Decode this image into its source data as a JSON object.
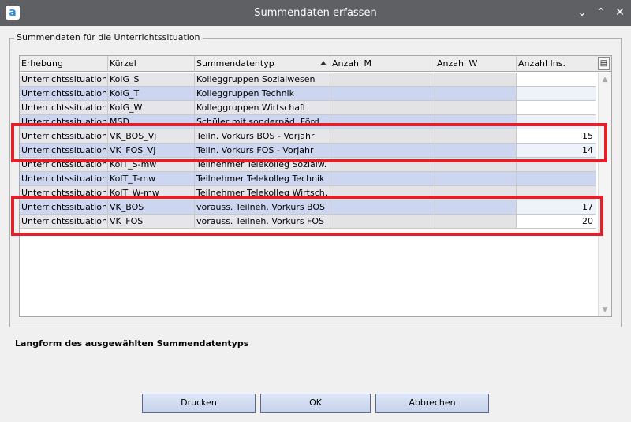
{
  "window": {
    "title": "Summendaten erfassen",
    "logo": "a"
  },
  "group_label": "Summendaten für die Unterrichtssituation",
  "columns": [
    "Erhebung",
    "Kürzel",
    "Summendatentyp",
    "Anzahl M",
    "Anzahl W",
    "Anzahl Ins."
  ],
  "rows": [
    {
      "erhebung": "Unterrichtssituation",
      "kuerzel": "KolG_S",
      "typ": "Kolleggruppen Sozialwesen",
      "m": "",
      "w": "",
      "ins": ""
    },
    {
      "erhebung": "Unterrichtssituation",
      "kuerzel": "KolG_T",
      "typ": "Kolleggruppen Technik",
      "m": "",
      "w": "",
      "ins": ""
    },
    {
      "erhebung": "Unterrichtssituation",
      "kuerzel": "KolG_W",
      "typ": "Kolleggruppen Wirtschaft",
      "m": "",
      "w": "",
      "ins": ""
    },
    {
      "erhebung": "Unterrichtssituation",
      "kuerzel": "MSD",
      "typ": "Schüler mit sonderpäd. Förd.",
      "m": "",
      "w": "",
      "ins": ""
    },
    {
      "erhebung": "Unterrichtssituation",
      "kuerzel": "VK_BOS_Vj",
      "typ": "Teiln. Vorkurs BOS - Vorjahr",
      "m": "",
      "w": "",
      "ins": "15"
    },
    {
      "erhebung": "Unterrichtssituation",
      "kuerzel": "VK_FOS_Vj",
      "typ": "Teiln. Vorkurs FOS - Vorjahr",
      "m": "",
      "w": "",
      "ins": "14"
    },
    {
      "erhebung": "Unterrichtssituation",
      "kuerzel": "KolT_S-mw",
      "typ": "Teilnehmer Telekolleg Sozialw.",
      "m": "",
      "w": "",
      "ins": ""
    },
    {
      "erhebung": "Unterrichtssituation",
      "kuerzel": "KolT_T-mw",
      "typ": "Teilnehmer Telekolleg Technik",
      "m": "",
      "w": "",
      "ins": ""
    },
    {
      "erhebung": "Unterrichtssituation",
      "kuerzel": "KolT_W-mw",
      "typ": "Teilnehmer Telekolleg Wirtsch.",
      "m": "",
      "w": "",
      "ins": ""
    },
    {
      "erhebung": "Unterrichtssituation",
      "kuerzel": "VK_BOS",
      "typ": "vorauss. Teilneh. Vorkurs BOS",
      "m": "",
      "w": "",
      "ins": "17"
    },
    {
      "erhebung": "Unterrichtssituation",
      "kuerzel": "VK_FOS",
      "typ": "vorauss. Teilneh. Vorkurs FOS",
      "m": "",
      "w": "",
      "ins": "20"
    }
  ],
  "longform_label": "Langform des ausgewählten Summendatentyps",
  "buttons": {
    "print": "Drucken",
    "ok": "OK",
    "cancel": "Abbrechen"
  },
  "icons": {
    "minimize": "chevron-down-icon",
    "maximize": "chevron-up-icon",
    "close": "close-icon",
    "columns": "column-chooser-icon"
  },
  "colors": {
    "highlight": "#e0202a",
    "row_blue": "#ccd6f0",
    "titlebar": "#5e6064"
  }
}
